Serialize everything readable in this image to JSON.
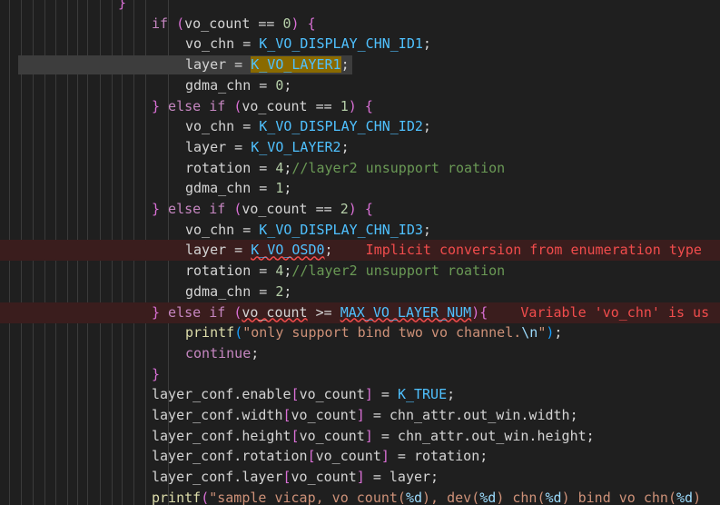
{
  "code_lines": [
    {
      "tokens": [
        {
          "t": "}",
          "c": "p2"
        }
      ]
    },
    {
      "tokens": [
        {
          "t": "if",
          "c": "kw"
        },
        {
          "t": " ",
          "c": "op"
        },
        {
          "t": "(",
          "c": "p2"
        },
        {
          "t": "vo_count == ",
          "c": "id"
        },
        {
          "t": "0",
          "c": "num"
        },
        {
          "t": ")",
          "c": "p2"
        },
        {
          "t": " ",
          "c": "op"
        },
        {
          "t": "{",
          "c": "p2"
        }
      ]
    },
    {
      "tokens": [
        {
          "t": "vo_chn = ",
          "c": "id"
        },
        {
          "t": "K_VO_DISPLAY_CHN_ID1",
          "c": "mac"
        },
        {
          "t": ";",
          "c": "id"
        }
      ]
    },
    {
      "tokens": [
        {
          "t": "layer = ",
          "c": "id"
        },
        {
          "t": "K_VO_LAYER1",
          "c": "mac sel"
        },
        {
          "t": ";",
          "c": "id"
        }
      ]
    },
    {
      "tokens": [
        {
          "t": "gdma_chn = ",
          "c": "id"
        },
        {
          "t": "0",
          "c": "num"
        },
        {
          "t": ";",
          "c": "id"
        }
      ]
    },
    {
      "tokens": [
        {
          "t": "}",
          "c": "p2"
        },
        {
          "t": " else if ",
          "c": "kw"
        },
        {
          "t": "(",
          "c": "p2"
        },
        {
          "t": "vo_count == ",
          "c": "id"
        },
        {
          "t": "1",
          "c": "num"
        },
        {
          "t": ")",
          "c": "p2"
        },
        {
          "t": " ",
          "c": "op"
        },
        {
          "t": "{",
          "c": "p2"
        }
      ]
    },
    {
      "tokens": [
        {
          "t": "vo_chn = ",
          "c": "id"
        },
        {
          "t": "K_VO_DISPLAY_CHN_ID2",
          "c": "mac"
        },
        {
          "t": ";",
          "c": "id"
        }
      ]
    },
    {
      "tokens": [
        {
          "t": "layer = ",
          "c": "id"
        },
        {
          "t": "K_VO_LAYER2",
          "c": "mac"
        },
        {
          "t": ";",
          "c": "id"
        }
      ]
    },
    {
      "tokens": [
        {
          "t": "rotation = ",
          "c": "id"
        },
        {
          "t": "4",
          "c": "num"
        },
        {
          "t": ";",
          "c": "id"
        },
        {
          "t": "//layer2 unsupport roation",
          "c": "cmt"
        }
      ]
    },
    {
      "tokens": [
        {
          "t": "gdma_chn = ",
          "c": "id"
        },
        {
          "t": "1",
          "c": "num"
        },
        {
          "t": ";",
          "c": "id"
        }
      ]
    },
    {
      "tokens": [
        {
          "t": "}",
          "c": "p2"
        },
        {
          "t": " else if ",
          "c": "kw"
        },
        {
          "t": "(",
          "c": "p2"
        },
        {
          "t": "vo_count == ",
          "c": "id"
        },
        {
          "t": "2",
          "c": "num"
        },
        {
          "t": ")",
          "c": "p2"
        },
        {
          "t": " ",
          "c": "op"
        },
        {
          "t": "{",
          "c": "p2"
        }
      ]
    },
    {
      "tokens": [
        {
          "t": "vo_chn = ",
          "c": "id"
        },
        {
          "t": "K_VO_DISPLAY_CHN_ID3",
          "c": "mac"
        },
        {
          "t": ";",
          "c": "id"
        }
      ]
    },
    {
      "error": true,
      "tokens": [
        {
          "t": "layer = ",
          "c": "id"
        },
        {
          "t": "K_VO_OSD0",
          "c": "mac squig"
        },
        {
          "t": ";",
          "c": "id"
        },
        {
          "t": "    Implicit conversion from enumeration type",
          "c": "err-msg"
        }
      ]
    },
    {
      "tokens": [
        {
          "t": "rotation = ",
          "c": "id"
        },
        {
          "t": "4",
          "c": "num"
        },
        {
          "t": ";",
          "c": "id"
        },
        {
          "t": "//layer2 unsupport roation",
          "c": "cmt"
        }
      ]
    },
    {
      "tokens": [
        {
          "t": "gdma_chn = ",
          "c": "id"
        },
        {
          "t": "2",
          "c": "num"
        },
        {
          "t": ";",
          "c": "id"
        }
      ]
    },
    {
      "error": true,
      "tokens": [
        {
          "t": "}",
          "c": "p2"
        },
        {
          "t": " else if ",
          "c": "kw"
        },
        {
          "t": "(",
          "c": "p2"
        },
        {
          "t": "vo_count",
          "c": "id squig"
        },
        {
          "t": " >= ",
          "c": "id"
        },
        {
          "t": "MAX_VO_LAYER_NUM",
          "c": "mac squig"
        },
        {
          "t": ")",
          "c": "p2"
        },
        {
          "t": "{",
          "c": "p2"
        },
        {
          "t": "    Variable 'vo_chn' is us",
          "c": "err-msg"
        }
      ]
    },
    {
      "tokens": [
        {
          "t": "printf",
          "c": "fn"
        },
        {
          "t": "(",
          "c": "p3"
        },
        {
          "t": "\"only support bind two vo channel.",
          "c": "str"
        },
        {
          "t": "\\n",
          "c": "fmt"
        },
        {
          "t": "\"",
          "c": "str"
        },
        {
          "t": ")",
          "c": "p3"
        },
        {
          "t": ";",
          "c": "id"
        }
      ]
    },
    {
      "tokens": [
        {
          "t": "continue",
          "c": "kw"
        },
        {
          "t": ";",
          "c": "id"
        }
      ]
    },
    {
      "tokens": [
        {
          "t": "}",
          "c": "p2"
        }
      ]
    },
    {
      "tokens": [
        {
          "t": "layer_conf.enable",
          "c": "id"
        },
        {
          "t": "[",
          "c": "p2"
        },
        {
          "t": "vo_count",
          "c": "id"
        },
        {
          "t": "]",
          "c": "p2"
        },
        {
          "t": " = ",
          "c": "id"
        },
        {
          "t": "K_TRUE",
          "c": "mac"
        },
        {
          "t": ";",
          "c": "id"
        }
      ]
    },
    {
      "tokens": [
        {
          "t": "layer_conf.width",
          "c": "id"
        },
        {
          "t": "[",
          "c": "p2"
        },
        {
          "t": "vo_count",
          "c": "id"
        },
        {
          "t": "]",
          "c": "p2"
        },
        {
          "t": " = chn_attr.out_win.width;",
          "c": "id"
        }
      ]
    },
    {
      "tokens": [
        {
          "t": "layer_conf.height",
          "c": "id"
        },
        {
          "t": "[",
          "c": "p2"
        },
        {
          "t": "vo_count",
          "c": "id"
        },
        {
          "t": "]",
          "c": "p2"
        },
        {
          "t": " = chn_attr.out_win.height;",
          "c": "id"
        }
      ]
    },
    {
      "tokens": [
        {
          "t": "layer_conf.rotation",
          "c": "id"
        },
        {
          "t": "[",
          "c": "p2"
        },
        {
          "t": "vo_count",
          "c": "id"
        },
        {
          "t": "]",
          "c": "p2"
        },
        {
          "t": " = rotation;",
          "c": "id"
        }
      ]
    },
    {
      "tokens": [
        {
          "t": "layer_conf.layer",
          "c": "id"
        },
        {
          "t": "[",
          "c": "p2"
        },
        {
          "t": "vo_count",
          "c": "id"
        },
        {
          "t": "]",
          "c": "p2"
        },
        {
          "t": " = layer;",
          "c": "id"
        }
      ]
    },
    {
      "tokens": [
        {
          "t": "printf",
          "c": "fn"
        },
        {
          "t": "(",
          "c": "p2"
        },
        {
          "t": "\"sample_vicap, vo_count(",
          "c": "str"
        },
        {
          "t": "%d",
          "c": "fmt"
        },
        {
          "t": "), dev(",
          "c": "str"
        },
        {
          "t": "%d",
          "c": "fmt"
        },
        {
          "t": ") chn(",
          "c": "str"
        },
        {
          "t": "%d",
          "c": "fmt"
        },
        {
          "t": ") bind vo chn(",
          "c": "str"
        },
        {
          "t": "%d",
          "c": "fmt"
        },
        {
          "t": ")",
          "c": "str"
        }
      ]
    }
  ]
}
